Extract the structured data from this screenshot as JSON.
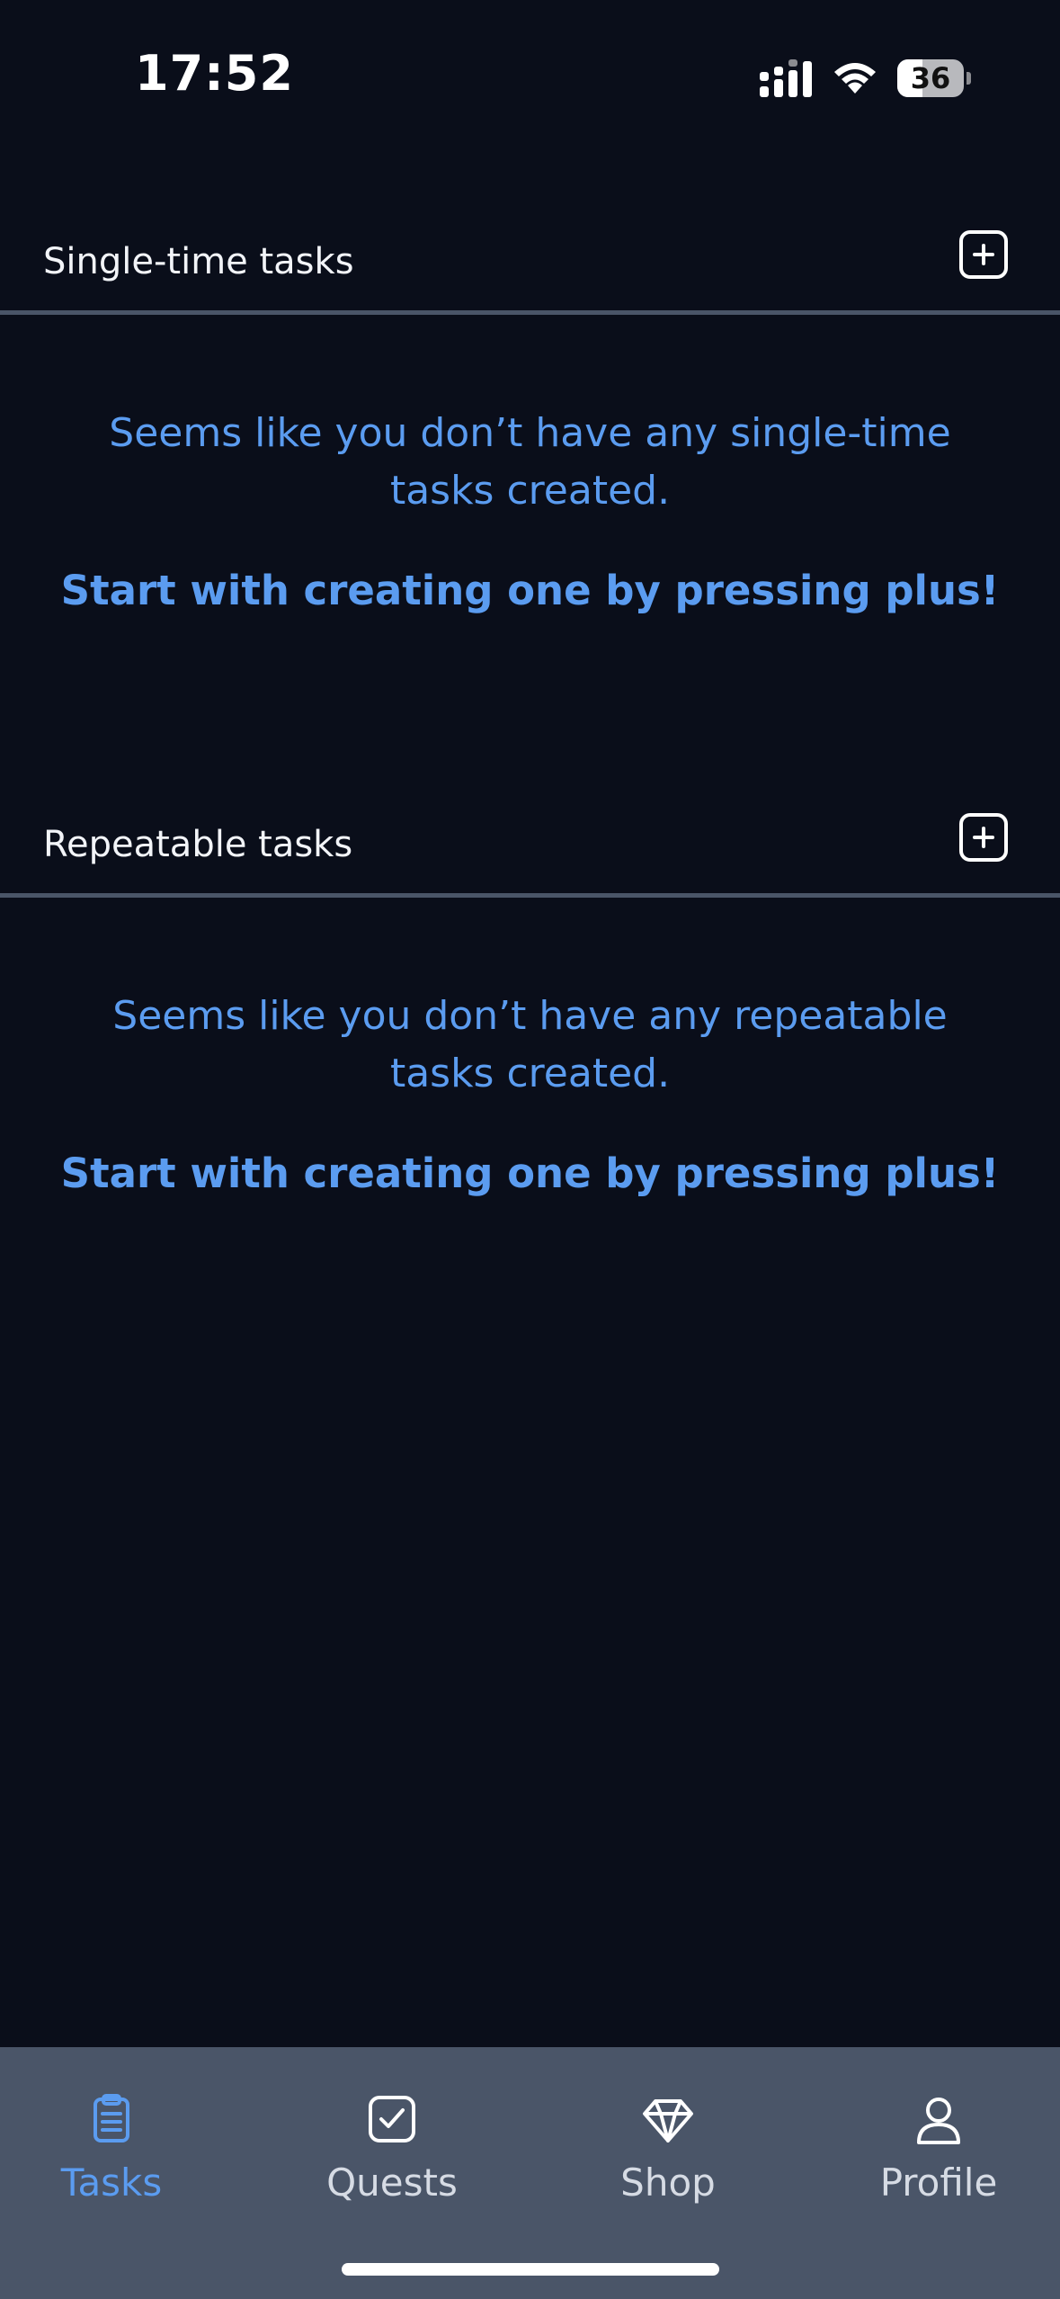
{
  "status_bar": {
    "time": "17:52",
    "battery": "36",
    "icons": [
      "cellular-signal-icon",
      "wifi-icon",
      "battery-icon"
    ]
  },
  "sections": {
    "single": {
      "title": "Single-time tasks",
      "add_icon": "plus-square-icon",
      "empty_message": "Seems like you don’t have any single-time tasks created.",
      "cta": "Start with creating one by pressing plus!"
    },
    "repeatable": {
      "title": "Repeatable tasks",
      "add_icon": "plus-square-icon",
      "empty_message": "Seems like you don’t have any repeatable tasks created.",
      "cta": "Start with creating one by pressing plus!"
    }
  },
  "nav": {
    "active": "Tasks",
    "items": [
      {
        "label": "Tasks",
        "icon": "clipboard-icon"
      },
      {
        "label": "Quests",
        "icon": "checkbox-icon"
      },
      {
        "label": "Shop",
        "icon": "diamond-icon"
      },
      {
        "label": "Profile",
        "icon": "user-icon"
      }
    ]
  },
  "colors": {
    "background": "#0a0e1a",
    "accent": "#5b9cf0",
    "nav_background": "#4a5568",
    "divider": "#4a5568",
    "text": "#f2f4f8"
  }
}
